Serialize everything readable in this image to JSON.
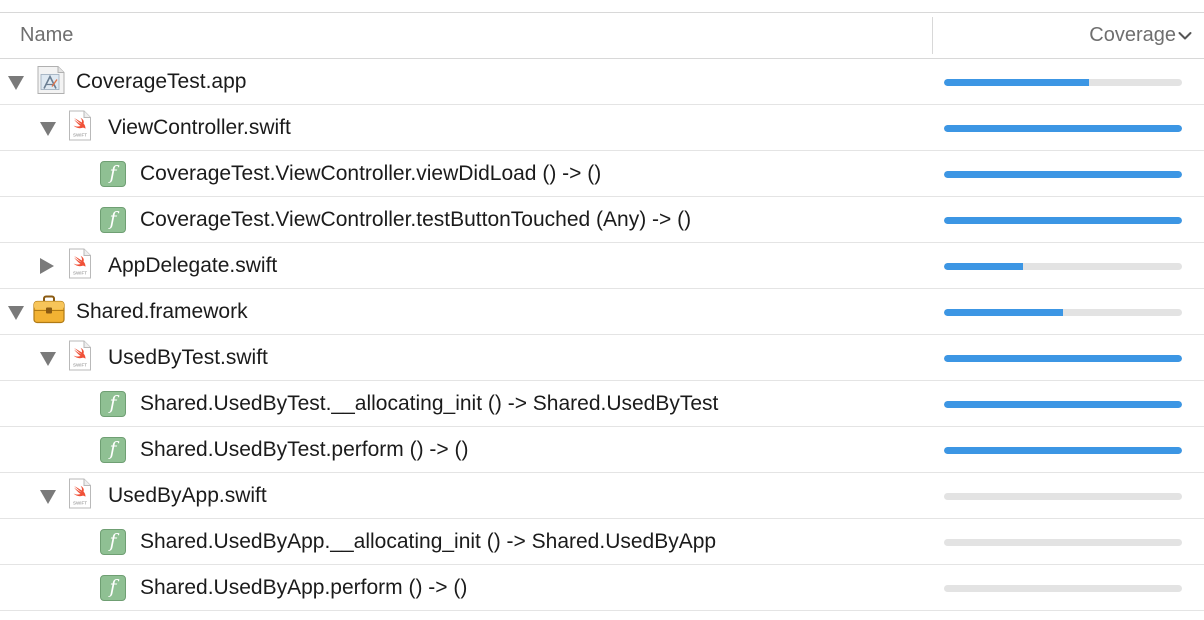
{
  "header": {
    "name_label": "Name",
    "coverage_label": "Coverage"
  },
  "colors": {
    "bar_fill": "#3c96e4",
    "bar_track": "#e3e3e3"
  },
  "rows": [
    {
      "label": "CoverageTest.app",
      "level": 0,
      "icon": "app-icon",
      "disclosure": "open",
      "coverage": 0.61
    },
    {
      "label": "ViewController.swift",
      "level": 1,
      "icon": "swift-file-icon",
      "disclosure": "open",
      "coverage": 1.0
    },
    {
      "label": "CoverageTest.ViewController.viewDidLoad () -> ()",
      "level": 2,
      "icon": "function-icon",
      "disclosure": "none",
      "coverage": 1.0
    },
    {
      "label": "CoverageTest.ViewController.testButtonTouched (Any) -> ()",
      "level": 2,
      "icon": "function-icon",
      "disclosure": "none",
      "coverage": 1.0
    },
    {
      "label": "AppDelegate.swift",
      "level": 1,
      "icon": "swift-file-icon",
      "disclosure": "closed",
      "coverage": 0.33
    },
    {
      "label": "Shared.framework",
      "level": 0,
      "icon": "framework-icon",
      "disclosure": "open",
      "coverage": 0.5
    },
    {
      "label": "UsedByTest.swift",
      "level": 1,
      "icon": "swift-file-icon",
      "disclosure": "open",
      "coverage": 1.0
    },
    {
      "label": "Shared.UsedByTest.__allocating_init () -> Shared.UsedByTest",
      "level": 2,
      "icon": "function-icon",
      "disclosure": "none",
      "coverage": 1.0
    },
    {
      "label": "Shared.UsedByTest.perform () -> ()",
      "level": 2,
      "icon": "function-icon",
      "disclosure": "none",
      "coverage": 1.0
    },
    {
      "label": "UsedByApp.swift",
      "level": 1,
      "icon": "swift-file-icon",
      "disclosure": "open",
      "coverage": 0.0
    },
    {
      "label": "Shared.UsedByApp.__allocating_init () -> Shared.UsedByApp",
      "level": 2,
      "icon": "function-icon",
      "disclosure": "none",
      "coverage": 0.0
    },
    {
      "label": "Shared.UsedByApp.perform () -> ()",
      "level": 2,
      "icon": "function-icon",
      "disclosure": "none",
      "coverage": 0.0
    }
  ]
}
